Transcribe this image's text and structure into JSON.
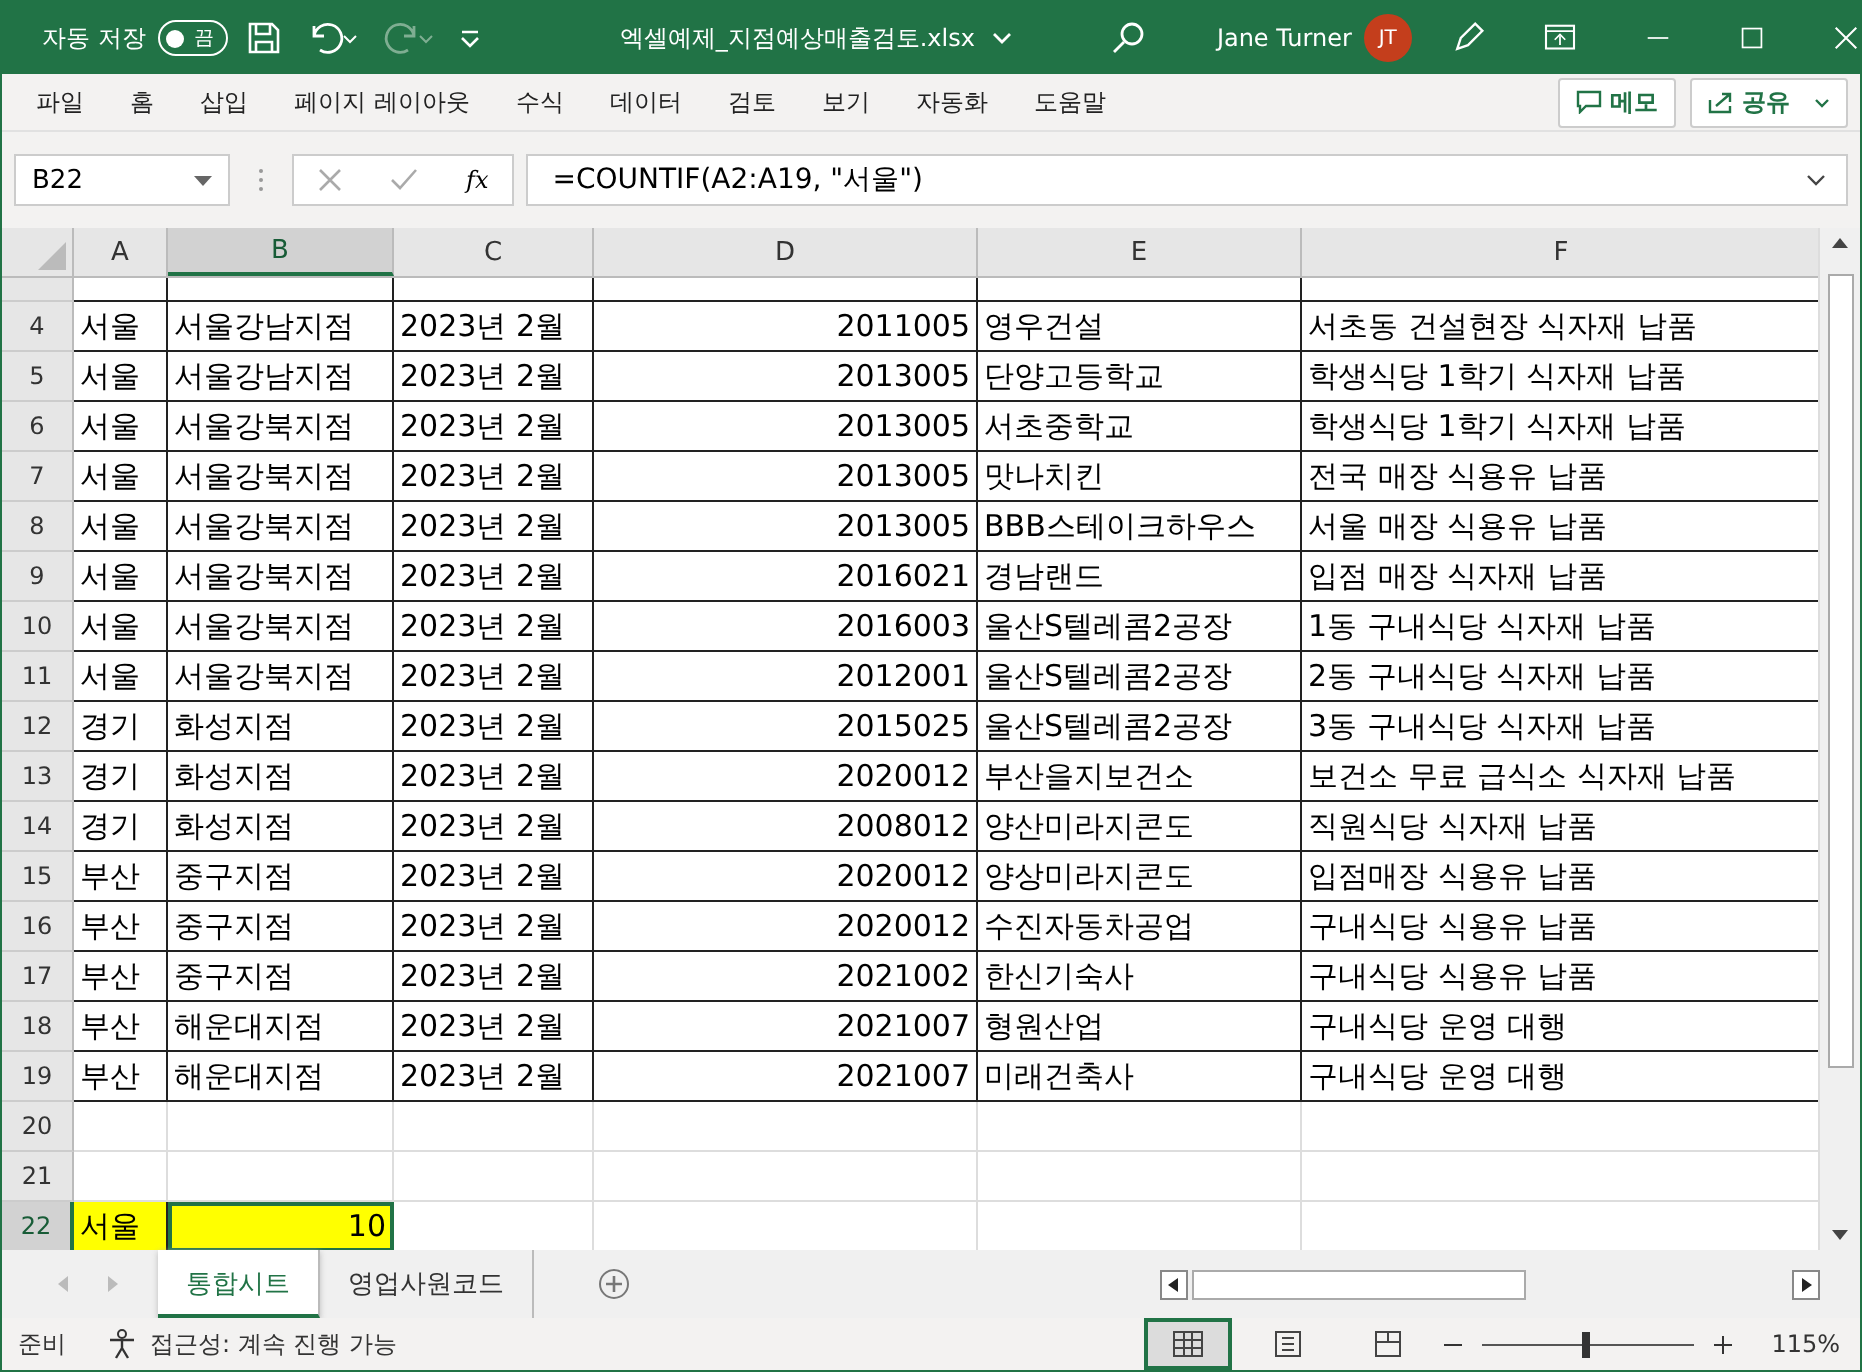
{
  "title_bar": {
    "autosave_label": "자동 저장",
    "autosave": {
      "on": false,
      "label": "끔"
    },
    "file_name": "엑셀예제_지점예상매출검토.xlsx",
    "user_name": "Jane Turner",
    "avatar_initials": "JT"
  },
  "menu": {
    "items": [
      "파일",
      "홈",
      "삽입",
      "페이지 레이아웃",
      "수식",
      "데이터",
      "검토",
      "보기",
      "자동화",
      "도움말"
    ],
    "memo_button": "메모",
    "share_button": "공유"
  },
  "formula_bar": {
    "name_box": "B22",
    "fx": "fx",
    "formula": "=COUNTIF(A2:A19, \"서울\")"
  },
  "columns": [
    {
      "label": "A",
      "selected": false
    },
    {
      "label": "B",
      "selected": true
    },
    {
      "label": "C",
      "selected": false
    },
    {
      "label": "D",
      "selected": false
    },
    {
      "label": "E",
      "selected": false
    },
    {
      "label": "F",
      "selected": false
    }
  ],
  "rows": [
    {
      "number": "4",
      "kind": "data",
      "selected": false,
      "cells": [
        "서울",
        "서울강남지점",
        "2023년 2월",
        "2011005",
        "영우건설",
        "서초동 건설현장 식자재 납품"
      ]
    },
    {
      "number": "5",
      "kind": "data",
      "selected": false,
      "cells": [
        "서울",
        "서울강남지점",
        "2023년 2월",
        "2013005",
        "단양고등학교",
        "학생식당 1학기 식자재 납품"
      ]
    },
    {
      "number": "6",
      "kind": "data",
      "selected": false,
      "cells": [
        "서울",
        "서울강북지점",
        "2023년 2월",
        "2013005",
        "서초중학교",
        "학생식당 1학기 식자재 납품"
      ]
    },
    {
      "number": "7",
      "kind": "data",
      "selected": false,
      "cells": [
        "서울",
        "서울강북지점",
        "2023년 2월",
        "2013005",
        "맛나치킨",
        "전국 매장 식용유 납품"
      ]
    },
    {
      "number": "8",
      "kind": "data",
      "selected": false,
      "cells": [
        "서울",
        "서울강북지점",
        "2023년 2월",
        "2013005",
        "BBB스테이크하우스",
        "서울 매장 식용유 납품"
      ]
    },
    {
      "number": "9",
      "kind": "data",
      "selected": false,
      "cells": [
        "서울",
        "서울강북지점",
        "2023년 2월",
        "2016021",
        "경남랜드",
        "입점 매장 식자재 납품"
      ]
    },
    {
      "number": "10",
      "kind": "data",
      "selected": false,
      "cells": [
        "서울",
        "서울강북지점",
        "2023년 2월",
        "2016003",
        "울산S텔레콤2공장",
        "1동 구내식당 식자재 납품"
      ]
    },
    {
      "number": "11",
      "kind": "data",
      "selected": false,
      "cells": [
        "서울",
        "서울강북지점",
        "2023년 2월",
        "2012001",
        "울산S텔레콤2공장",
        "2동 구내식당 식자재 납품"
      ]
    },
    {
      "number": "12",
      "kind": "data",
      "selected": false,
      "cells": [
        "경기",
        "화성지점",
        "2023년 2월",
        "2015025",
        "울산S텔레콤2공장",
        "3동 구내식당 식자재 납품"
      ]
    },
    {
      "number": "13",
      "kind": "data",
      "selected": false,
      "cells": [
        "경기",
        "화성지점",
        "2023년 2월",
        "2020012",
        "부산을지보건소",
        "보건소 무료 급식소 식자재 납품"
      ]
    },
    {
      "number": "14",
      "kind": "data",
      "selected": false,
      "cells": [
        "경기",
        "화성지점",
        "2023년 2월",
        "2008012",
        "양산미라지콘도",
        "직원식당 식자재 납품"
      ]
    },
    {
      "number": "15",
      "kind": "data",
      "selected": false,
      "cells": [
        "부산",
        "중구지점",
        "2023년 2월",
        "2020012",
        "양상미라지콘도",
        "입점매장 식용유 납품"
      ]
    },
    {
      "number": "16",
      "kind": "data",
      "selected": false,
      "cells": [
        "부산",
        "중구지점",
        "2023년 2월",
        "2020012",
        "수진자동차공업",
        "구내식당 식용유 납품"
      ]
    },
    {
      "number": "17",
      "kind": "data",
      "selected": false,
      "cells": [
        "부산",
        "중구지점",
        "2023년 2월",
        "2021002",
        "한신기숙사",
        "구내식당 식용유 납품"
      ]
    },
    {
      "number": "18",
      "kind": "data",
      "selected": false,
      "cells": [
        "부산",
        "해운대지점",
        "2023년 2월",
        "2021007",
        "형원산업",
        "구내식당 운영 대행"
      ]
    },
    {
      "number": "19",
      "kind": "data",
      "selected": false,
      "cells": [
        "부산",
        "해운대지점",
        "2023년 2월",
        "2021007",
        "미래건축사",
        "구내식당 운영 대행"
      ]
    },
    {
      "number": "20",
      "kind": "empty",
      "selected": false
    },
    {
      "number": "21",
      "kind": "empty",
      "selected": false
    },
    {
      "number": "22",
      "kind": "result",
      "selected": true,
      "cells": [
        "서울",
        "10"
      ]
    }
  ],
  "sheet_tabs": [
    {
      "label": "통합시트",
      "selected": true
    },
    {
      "label": "영업사원코드",
      "selected": false
    }
  ],
  "status_bar": {
    "mode": "준비",
    "accessibility": "접근성: 계속 진행 가능",
    "zoom": {
      "level": 0.49,
      "reading": "115%"
    }
  }
}
